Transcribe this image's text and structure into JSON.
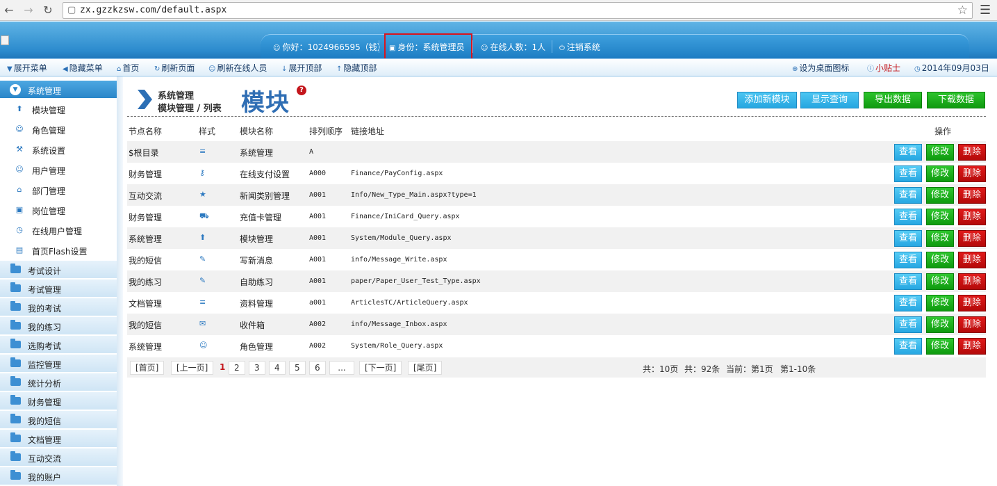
{
  "browser": {
    "url": "zx.gzzkzsw.com/default.aspx"
  },
  "topnav": {
    "greeting": "你好：1024966595（钱）",
    "role": "身份：系统管理员",
    "online": "在线人数：1人",
    "logout": "注销系统"
  },
  "toolbar": {
    "expand_menu": "展开菜单",
    "hide_menu": "隐藏菜单",
    "home": "首页",
    "refresh_page": "刷新页面",
    "refresh_online": "刷新在线人员",
    "expand_top": "展开顶部",
    "hide_top": "隐藏顶部",
    "set_desktop": "设为桌面图标",
    "tips": "小贴士",
    "date": "2014年09月03日"
  },
  "sidebar": {
    "active_section": "系统管理",
    "sub_items": [
      "模块管理",
      "角色管理",
      "系统设置",
      "用户管理",
      "部门管理",
      "岗位管理",
      "在线用户管理",
      "首页Flash设置"
    ],
    "sections": [
      "考试设计",
      "考试管理",
      "我的考试",
      "我的练习",
      "选购考试",
      "监控管理",
      "统计分析",
      "财务管理",
      "我的短信",
      "文档管理",
      "互动交流",
      "我的账户"
    ]
  },
  "header": {
    "title": "系统管理",
    "crumb": "模块管理 / 列表",
    "big": "模块",
    "help": "?"
  },
  "actions": {
    "add": "添加新模块",
    "show_query": "显示查询",
    "export": "导出数据",
    "download": "下载数据"
  },
  "table": {
    "headers": [
      "节点名称",
      "样式",
      "模块名称",
      "排列顺序",
      "链接地址",
      "操作"
    ],
    "rows": [
      {
        "node": "$根目录",
        "style": "≡",
        "name": "系统管理",
        "order": "A",
        "link": ""
      },
      {
        "node": "财务管理",
        "style": "⚷",
        "name": "在线支付设置",
        "order": "A000",
        "link": "Finance/PayConfig.aspx"
      },
      {
        "node": "互动交流",
        "style": "★",
        "name": "新闻类别管理",
        "order": "A001",
        "link": "Info/New_Type_Main.aspx?type=1"
      },
      {
        "node": "财务管理",
        "style": "⛟",
        "name": "充值卡管理",
        "order": "A001",
        "link": "Finance/IniCard_Query.aspx"
      },
      {
        "node": "系统管理",
        "style": "⬆",
        "name": "模块管理",
        "order": "A001",
        "link": "System/Module_Query.aspx"
      },
      {
        "node": "我的短信",
        "style": "✎",
        "name": "写新消息",
        "order": "A001",
        "link": "info/Message_Write.aspx"
      },
      {
        "node": "我的练习",
        "style": "✎",
        "name": "自助练习",
        "order": "A001",
        "link": "paper/Paper_User_Test_Type.aspx"
      },
      {
        "node": "文档管理",
        "style": "≡",
        "name": "资料管理",
        "order": "a001",
        "link": "ArticlesTC/ArticleQuery.aspx"
      },
      {
        "node": "我的短信",
        "style": "✉",
        "name": "收件箱",
        "order": "A002",
        "link": "info/Message_Inbox.aspx"
      },
      {
        "node": "系统管理",
        "style": "☺",
        "name": "角色管理",
        "order": "A002",
        "link": "System/Role_Query.aspx"
      }
    ],
    "row_actions": {
      "view": "查看",
      "edit": "修改",
      "delete": "删除"
    }
  },
  "pager": {
    "first": "[首页]",
    "prev": "[上一页]",
    "pages": [
      "1",
      "2",
      "3",
      "4",
      "5",
      "6",
      "..."
    ],
    "next": "[下一页]",
    "last": "[尾页]",
    "total_pages": "共：10页",
    "total_items": "共：92条",
    "current": "当前：第1页",
    "range": "第1-10条"
  },
  "colors": {
    "accent": "#2a86c9",
    "highlight_box": "#d9141d",
    "delete": "#c4161c",
    "edit": "#109a10"
  }
}
